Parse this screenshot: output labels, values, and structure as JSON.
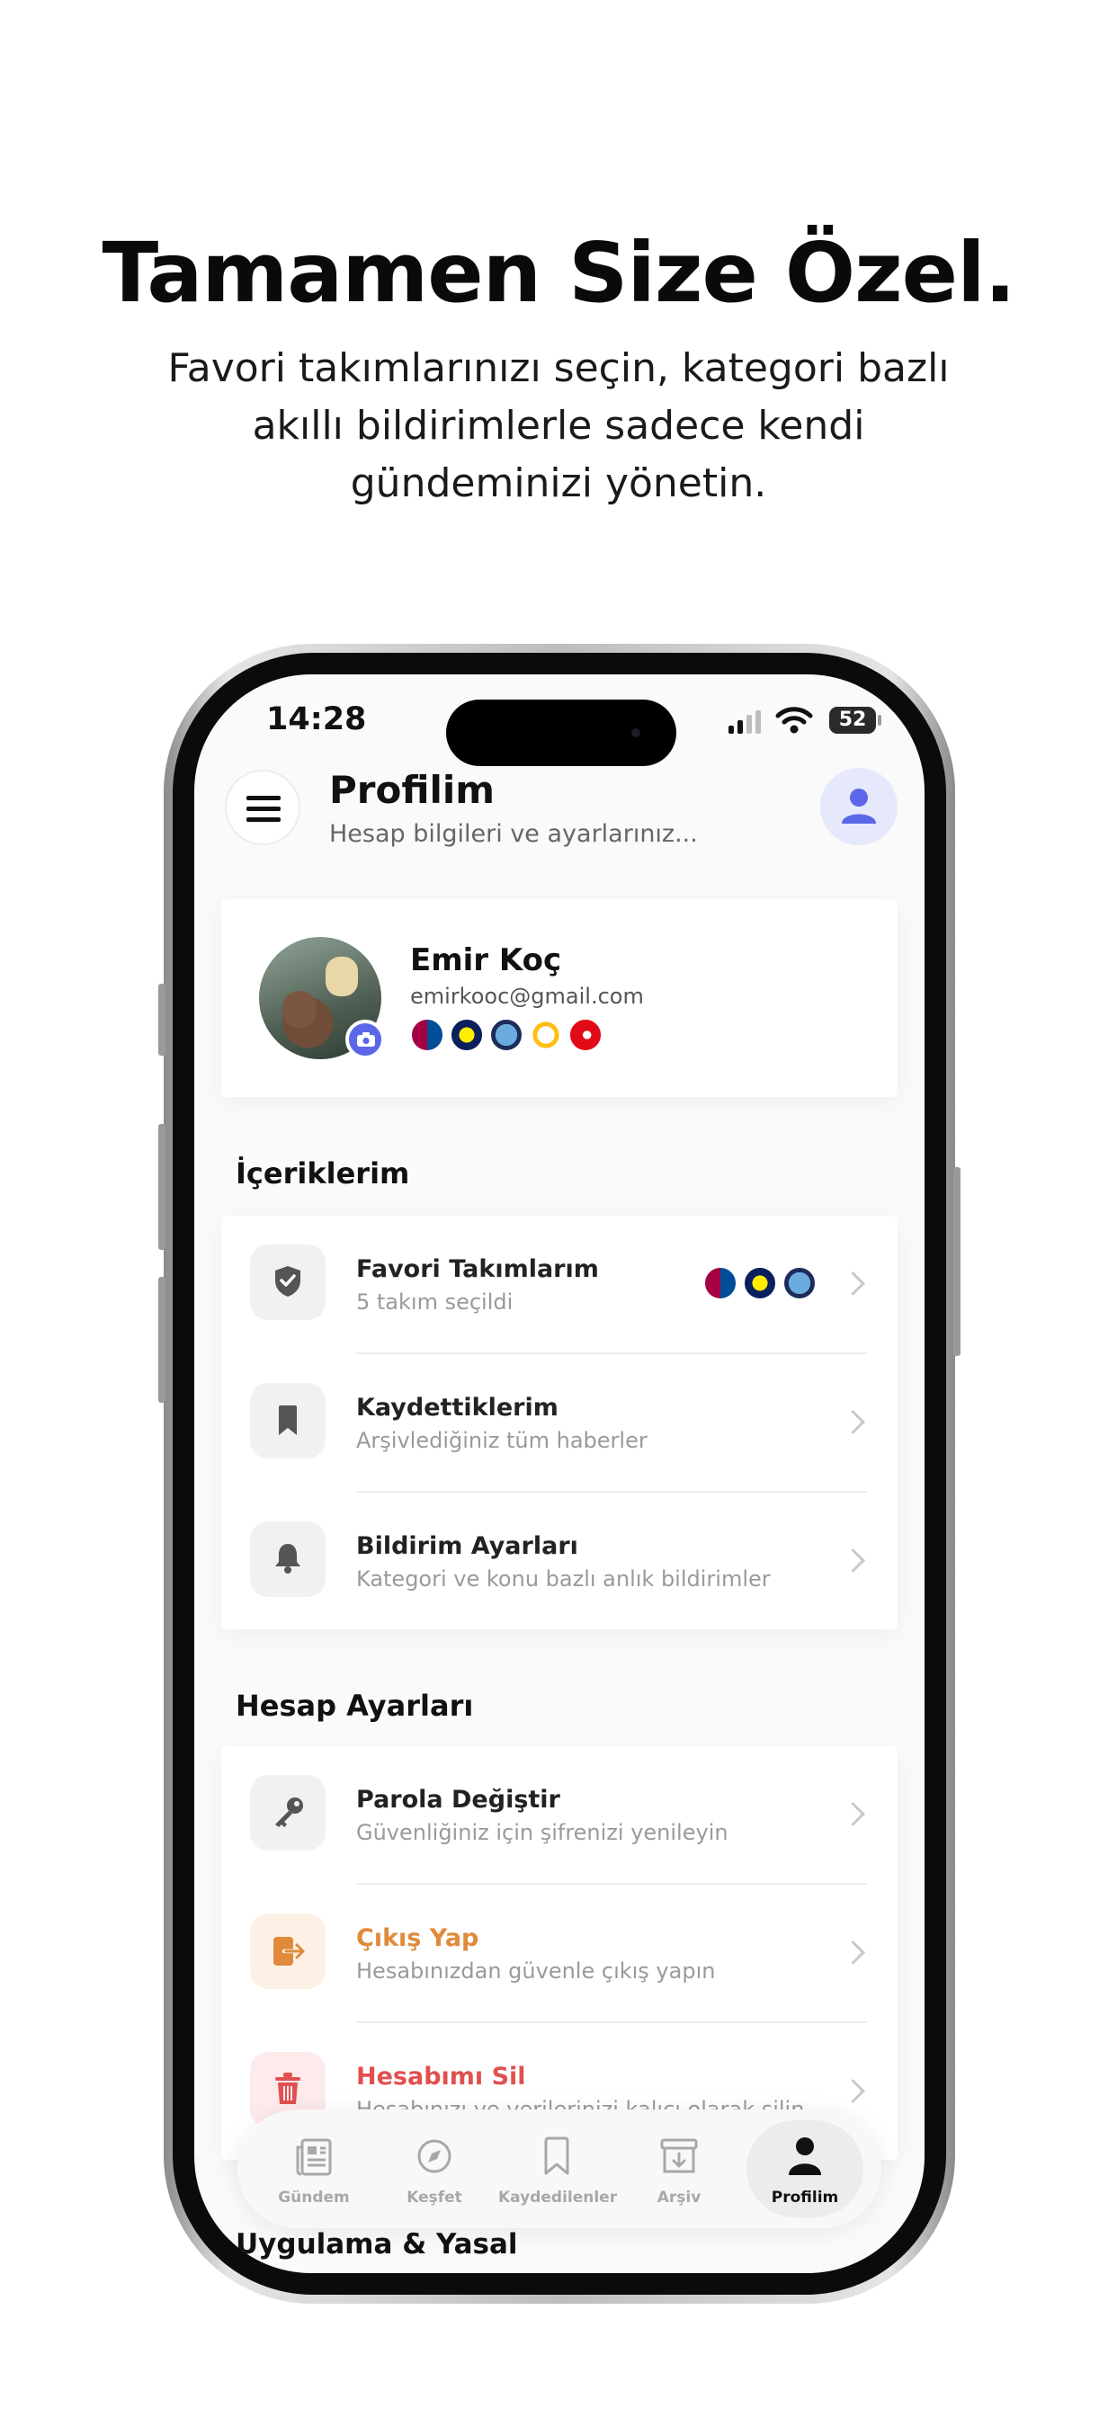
{
  "headline": "Tamamen Size Özel.",
  "subheadline_lines": [
    "Favori takımlarınızı seçin, kategori bazlı",
    "akıllı bildirimlerle sadece kendi",
    "gündeminizi yönetin."
  ],
  "status_bar": {
    "time": "14:28",
    "battery": "52"
  },
  "header": {
    "title": "Profilim",
    "subtitle": "Hesap bilgileri ve ayarlarınız..."
  },
  "profile": {
    "name": "Emir Koç",
    "email": "emirkooc@gmail.com",
    "team_badges": [
      "barcelona-badge",
      "fenerbahce-badge",
      "manchester-city-badge",
      "real-madrid-badge",
      "turkey-flag-badge"
    ]
  },
  "sections": {
    "content": {
      "title": "İçeriklerim",
      "items": [
        {
          "title": "Favori Takımlarım",
          "subtitle": "5 takım seçildi",
          "icon": "shield-check-icon"
        },
        {
          "title": "Kaydettiklerim",
          "subtitle": "Arşivlediğiniz tüm haberler",
          "icon": "bookmark-icon"
        },
        {
          "title": "Bildirim Ayarları",
          "subtitle": "Kategori ve konu bazlı anlık bildirimler",
          "icon": "bell-icon"
        }
      ]
    },
    "account": {
      "title": "Hesap Ayarları",
      "items": [
        {
          "title": "Parola Değiştir",
          "subtitle": "Güvenliğiniz için şifrenizi yenileyin",
          "icon": "key-icon"
        },
        {
          "title": "Çıkış Yap",
          "subtitle": "Hesabınızdan güvenle çıkış yapın",
          "icon": "logout-icon",
          "color": "#e08a3c"
        },
        {
          "title": "Hesabımı Sil",
          "subtitle": "Hesabınızı ve verilerinizi kalıcı olarak silin",
          "icon": "trash-icon",
          "color": "#e0504f"
        }
      ]
    },
    "app_legal": {
      "title": "Uygulama & Yasal"
    }
  },
  "tabbar": {
    "tabs": [
      {
        "label": "Gündem",
        "icon": "newspaper-icon"
      },
      {
        "label": "Keşfet",
        "icon": "compass-icon"
      },
      {
        "label": "Kaydedilenler",
        "icon": "bookmark-outline-icon"
      },
      {
        "label": "Arşiv",
        "icon": "archive-icon"
      },
      {
        "label": "Profilim",
        "icon": "person-icon",
        "active": true
      }
    ]
  },
  "colors": {
    "accent": "#5b67e8",
    "orange": "#e08a3c",
    "red": "#e0504f"
  }
}
